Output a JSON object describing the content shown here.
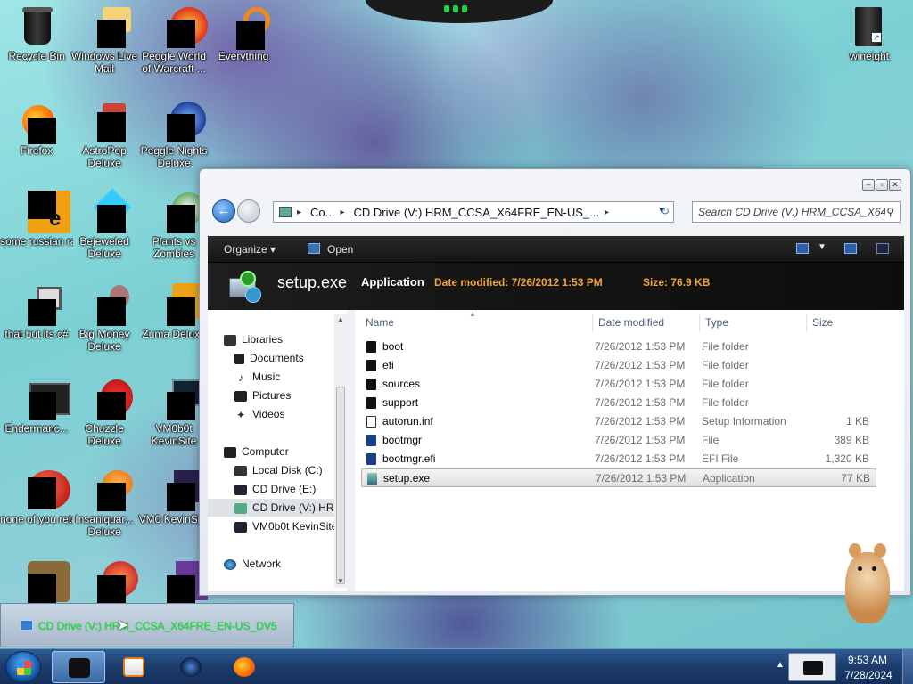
{
  "desktop": {
    "icons": [
      {
        "label": "Recycle Bin"
      },
      {
        "label": "Windows Live Mail"
      },
      {
        "label": "Peggle World of Warcraft ..."
      },
      {
        "label": "Everything"
      },
      {
        "label": "wineight"
      },
      {
        "label": "Firefox"
      },
      {
        "label": "AstroPop Deluxe"
      },
      {
        "label": "Peggle Nights Deluxe"
      },
      {
        "label": "some russian ran a rat"
      },
      {
        "label": "Bejeweled Deluxe"
      },
      {
        "label": "Plants vs Zombies"
      },
      {
        "label": "that but its c#"
      },
      {
        "label": "Big Money Deluxe"
      },
      {
        "label": "Zuma Deluxe"
      },
      {
        "label": "Endermanc..."
      },
      {
        "label": "Chuzzle Deluxe"
      },
      {
        "label": "VM0b0t KevinSite"
      },
      {
        "label": "none of you retards kno..."
      },
      {
        "label": "Insaniquar... Deluxe"
      },
      {
        "label": "VM0 KevinSi..."
      }
    ]
  },
  "window": {
    "address": {
      "crumb_computer": "Co...",
      "crumb_drive": "CD Drive (V:) HRM_CCSA_X64FRE_EN-US_...",
      "crumb_sep": "▸"
    },
    "search_placeholder": "Search CD Drive (V:) HRM_CCSA_X64...",
    "toolbar": {
      "organize": "Organize ▾",
      "open": "Open"
    },
    "details": {
      "file_name": "setup.exe",
      "file_type": "Application",
      "date_label": "Date modified: 7/26/2012 1:53 PM",
      "size_label": "Size: 76.9 KB"
    },
    "nav_tree": [
      {
        "label": "Libraries",
        "icon": "libraries-icon",
        "indent": 0
      },
      {
        "label": "Documents",
        "icon": "documents-icon",
        "indent": 1
      },
      {
        "label": "Music",
        "icon": "music-icon",
        "indent": 1
      },
      {
        "label": "Pictures",
        "icon": "pictures-icon",
        "indent": 1
      },
      {
        "label": "Videos",
        "icon": "videos-icon",
        "indent": 1
      },
      {
        "label": "Computer",
        "icon": "computer-icon",
        "indent": 0
      },
      {
        "label": "Local Disk (C:)",
        "icon": "drive-icon",
        "indent": 1
      },
      {
        "label": "CD Drive (E:)",
        "icon": "cd-drive-icon",
        "indent": 1
      },
      {
        "label": "CD Drive (V:) HRM",
        "icon": "cd-drive-icon",
        "indent": 1,
        "selected": true
      },
      {
        "label": "VM0b0t KevinSite",
        "icon": "network-drive-icon",
        "indent": 1
      },
      {
        "label": "Network",
        "icon": "network-icon",
        "indent": 0
      }
    ],
    "columns": {
      "name": "Name",
      "date": "Date modified",
      "type": "Type",
      "size": "Size"
    },
    "files": [
      {
        "name": "boot",
        "date": "7/26/2012 1:53 PM",
        "type": "File folder",
        "size": ""
      },
      {
        "name": "efi",
        "date": "7/26/2012 1:53 PM",
        "type": "File folder",
        "size": ""
      },
      {
        "name": "sources",
        "date": "7/26/2012 1:53 PM",
        "type": "File folder",
        "size": ""
      },
      {
        "name": "support",
        "date": "7/26/2012 1:53 PM",
        "type": "File folder",
        "size": ""
      },
      {
        "name": "autorun.inf",
        "date": "7/26/2012 1:53 PM",
        "type": "Setup Information",
        "size": "1 KB"
      },
      {
        "name": "bootmgr",
        "date": "7/26/2012 1:53 PM",
        "type": "File",
        "size": "389 KB"
      },
      {
        "name": "bootmgr.efi",
        "date": "7/26/2012 1:53 PM",
        "type": "EFI File",
        "size": "1,320 KB"
      },
      {
        "name": "setup.exe",
        "date": "7/26/2012 1:53 PM",
        "type": "Application",
        "size": "77 KB",
        "selected": true
      }
    ]
  },
  "copy_popup": {
    "text": "CD Drive (V:) HRM_CCSA_X64FRE_EN-US_DV5"
  },
  "taskbar": {
    "time": "9:53 AM",
    "date": "7/28/2024"
  },
  "colors": {
    "details_accent": "#f2a53a",
    "popup_text": "#2ddb3f"
  }
}
